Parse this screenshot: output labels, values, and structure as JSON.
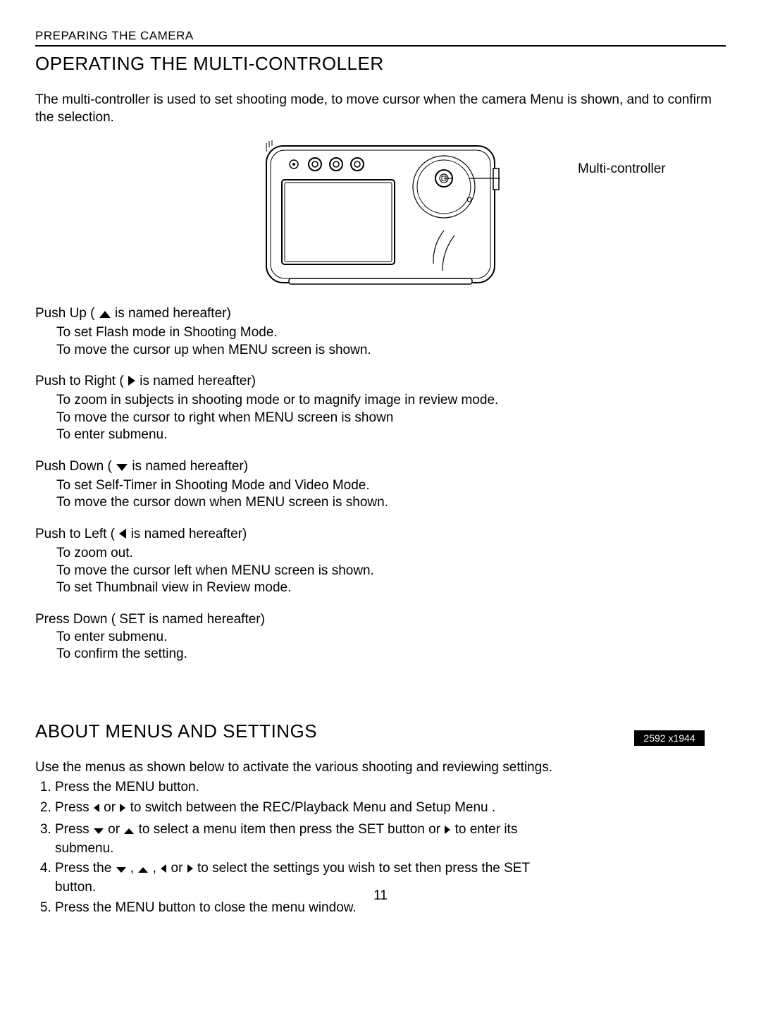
{
  "header": "PREPARING THE CAMERA",
  "title1": "OPERATING THE MULTI-CONTROLLER",
  "intro": "The multi-controller is used to set shooting mode, to move cursor when the camera Menu is shown, and to confirm the selection.",
  "callout": "Multi-controller",
  "up": {
    "lead_a": "Push Up  ( ",
    "lead_b": "  is named hereafter)",
    "l1": "To set Flash mode in Shooting Mode.",
    "l2": "To move the cursor up when MENU screen is shown."
  },
  "right": {
    "lead_a": "Push to Right   ( ",
    "lead_b": "  is named hereafter)",
    "l1": "To zoom in subjects in shooting mode or to magnify image in review mode.",
    "l2": "To move the cursor to right when MENU screen is shown",
    "l3": "To enter submenu."
  },
  "down": {
    "lead_a": "Push Down   ( ",
    "lead_b": "  is named hereafter)",
    "l1": "To set Self-Timer in Shooting Mode and Video Mode.",
    "l2": "To move the cursor down when MENU screen is shown."
  },
  "left": {
    "lead_a": "Push to Left   ( ",
    "lead_b": "  is named hereafter)",
    "l1": "To zoom out.",
    "l2": "To move the cursor left when MENU screen is shown.",
    "l3": "To set Thumbnail view in Review mode."
  },
  "set": {
    "lead": "Press Down   ( SET  is named hereafter)",
    "l1": "To enter submenu.",
    "l2": "To confirm the setting."
  },
  "title2": "ABOUT MENUS AND SETTINGS",
  "menus": {
    "intro": "Use the menus as shown below to activate the various shooting and reviewing settings.",
    "s1": "Press the MENU button.",
    "s2a": "Press ",
    "s2b": " or ",
    "s2c": " to switch between the REC/Playback  Menu  and Setup Menu .",
    "s3a": "Press ",
    "s3b": " or ",
    "s3c": " to select a menu item then press the SET button or ",
    "s3d": " to enter its submenu.",
    "s4a": "Press the ",
    "s4b": " , ",
    "s4c": " , ",
    "s4d": " or ",
    "s4e": " to select the settings you wish to set then press the SET button.",
    "s5": "Press the MENU button to close the menu window."
  },
  "badge": "2592 x1944",
  "pagenum": "11"
}
